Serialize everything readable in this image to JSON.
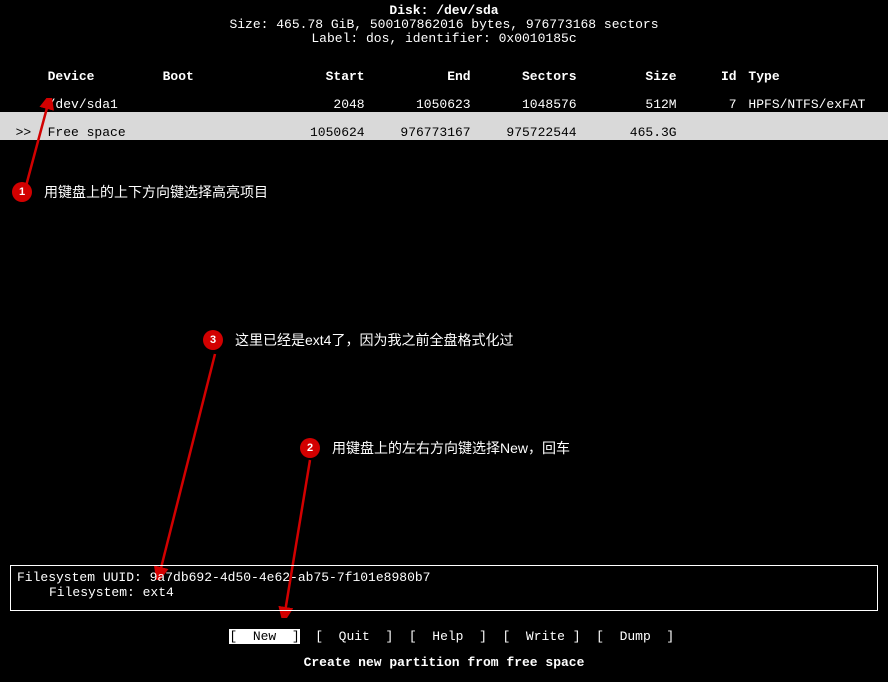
{
  "header": {
    "disk_line": "Disk: /dev/sda",
    "size_line": "Size: 465.78 GiB, 500107862016 bytes, 976773168 sectors",
    "label_line": "Label: dos, identifier: 0x0010185c"
  },
  "columns": {
    "device": "Device",
    "boot": "Boot",
    "start": "Start",
    "end": "End",
    "sectors": "Sectors",
    "size": "Size",
    "id": "Id",
    "type": "Type"
  },
  "rows": [
    {
      "mark": "",
      "device": "/dev/sda1",
      "boot": "",
      "start": "2048",
      "end": "1050623",
      "sectors": "1048576",
      "size": "512M",
      "id": "7",
      "type": "HPFS/NTFS/exFAT",
      "highlight": false
    },
    {
      "mark": ">>",
      "device": "Free space",
      "boot": "",
      "start": "1050624",
      "end": "976773167",
      "sectors": "975722544",
      "size": "465.3G",
      "id": "",
      "type": "",
      "highlight": true
    }
  ],
  "annotations": {
    "a1": "用键盘上的上下方向键选择高亮项目",
    "a2": "用键盘上的左右方向键选择New，回车",
    "a3": "这里已经是ext4了，因为我之前全盘格式化过"
  },
  "filesystem": {
    "uuid_label": "Filesystem UUID: ",
    "uuid": "9a7db692-4d50-4e62-ab75-7f101e8980b7",
    "fs_label": "Filesystem: ",
    "fs": "ext4"
  },
  "menu": {
    "new": "New",
    "quit": "Quit",
    "help": "Help",
    "write": "Write",
    "dump": "Dump"
  },
  "footer": "Create new partition from free space"
}
